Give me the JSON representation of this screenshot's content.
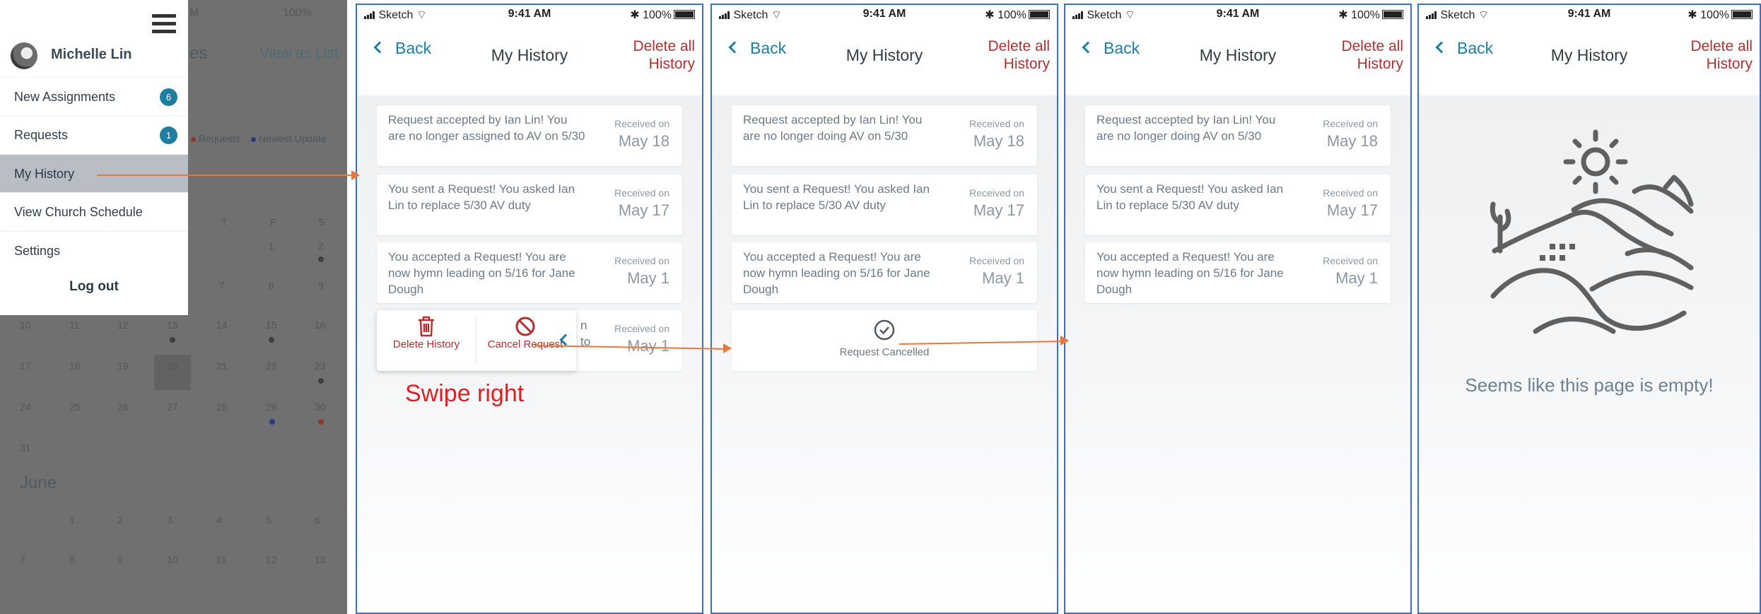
{
  "background_calendar": {
    "title_partial": "es",
    "view_link": "View as List",
    "legend": [
      {
        "label": "Requests",
        "color": "#8a3a2a"
      },
      {
        "label": "Newest Update",
        "color": "#2a3a8a"
      }
    ],
    "weekday_headers": [
      "T",
      "F",
      "S"
    ],
    "rows": [
      [
        "1",
        "2"
      ],
      [
        "7",
        "8",
        "9"
      ],
      [
        "10",
        "11",
        "12",
        "13",
        "14",
        "15",
        "16"
      ],
      [
        "17",
        "18",
        "19",
        "20",
        "21",
        "22",
        "23"
      ],
      [
        "24",
        "25",
        "26",
        "27",
        "28",
        "29",
        "30"
      ],
      [
        "31"
      ]
    ],
    "month_label": "June",
    "june_rows": [
      [
        "1",
        "2",
        "3",
        "4",
        "5",
        "6"
      ],
      [
        "7",
        "8",
        "9",
        "10",
        "11",
        "12",
        "13"
      ]
    ],
    "status_partial": "M",
    "status_batt": "100%"
  },
  "side_menu": {
    "user_name": "Michelle Lin",
    "items": [
      {
        "label": "New Assignments",
        "badge": "6"
      },
      {
        "label": "Requests",
        "badge": "1"
      },
      {
        "label": "My History",
        "active": true
      },
      {
        "label": "View Church Schedule"
      },
      {
        "label": "Settings"
      }
    ],
    "logout": "Log out"
  },
  "status_bar": {
    "carrier": "Sketch",
    "time": "9:41 AM",
    "battery": "100%"
  },
  "nav": {
    "back": "Back",
    "title": "My History",
    "delete_all": "Delete all History"
  },
  "cards": {
    "received_label": "Received on",
    "c1_panel2": {
      "message": "Request accepted by Ian Lin! You are no longer assigned to AV on 5/30",
      "date": "May 18"
    },
    "c1": {
      "message": "Request accepted by Ian Lin! You are no longer doing AV on 5/30",
      "date": "May 18"
    },
    "c2": {
      "message": "You sent a Request! You asked Ian Lin to replace 5/30 AV duty",
      "date": "May 17"
    },
    "c3": {
      "message": "You accepted a Request! You are now hymn leading on 5/16 for Jane Dough",
      "date": "May 1"
    },
    "c4_partial": {
      "message_fragment_1": "n",
      "message_fragment_2": "to",
      "date": "May 1"
    }
  },
  "swipe_actions": {
    "delete": "Delete History",
    "cancel": "Cancel Request"
  },
  "cancelled_text": "Request Cancelled",
  "annotation": "Swipe right",
  "empty_state": {
    "text": "Seems like this page is empty!"
  },
  "colors": {
    "accent_blue": "#1d7ea0",
    "delete_red": "#b03030",
    "annotation_red": "#e02020",
    "arrow_orange": "#e8773a",
    "frame_blue": "#3a6fd1"
  }
}
